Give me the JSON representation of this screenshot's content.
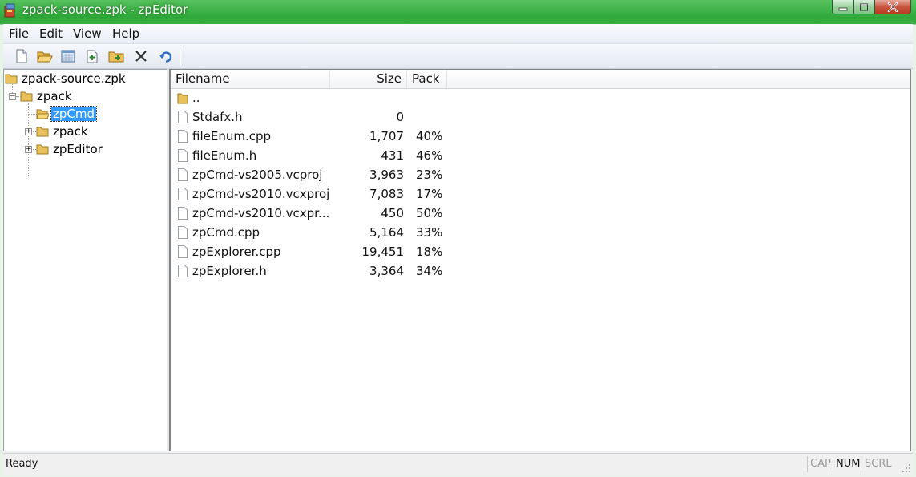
{
  "window": {
    "title": "zpack-source.zpk - zpEditor",
    "colors": {
      "frame": "#3aad45",
      "selection": "#3399ff",
      "folder": "#e8c15a"
    }
  },
  "menu": [
    "File",
    "Edit",
    "View",
    "Help"
  ],
  "toolbar": {
    "buttons": [
      "new-file-icon",
      "open-folder-icon",
      "save-archive-icon",
      "add-file-icon",
      "add-folder-icon",
      "delete-icon",
      "refresh-icon"
    ]
  },
  "tree": {
    "root": "zpack-source.zpk",
    "nodes": [
      {
        "label": "zpack",
        "expanded": true
      },
      {
        "label": "zpCmd",
        "selected": true
      },
      {
        "label": "zpack",
        "expanded": false
      },
      {
        "label": "zpEditor",
        "expanded": false
      }
    ]
  },
  "list": {
    "columns": [
      "Filename",
      "Size",
      "Pack"
    ],
    "rows": [
      {
        "name": "..",
        "size": "",
        "pack": "",
        "type": "folder"
      },
      {
        "name": "Stdafx.h",
        "size": "0",
        "pack": "",
        "type": "file"
      },
      {
        "name": "fileEnum.cpp",
        "size": "1,707",
        "pack": "40%",
        "type": "file"
      },
      {
        "name": "fileEnum.h",
        "size": "431",
        "pack": "46%",
        "type": "file"
      },
      {
        "name": "zpCmd-vs2005.vcproj",
        "size": "3,963",
        "pack": "23%",
        "type": "file"
      },
      {
        "name": "zpCmd-vs2010.vcxproj",
        "size": "7,083",
        "pack": "17%",
        "type": "file"
      },
      {
        "name": "zpCmd-vs2010.vcxpr...",
        "size": "450",
        "pack": "50%",
        "type": "file"
      },
      {
        "name": "zpCmd.cpp",
        "size": "5,164",
        "pack": "33%",
        "type": "file"
      },
      {
        "name": "zpExplorer.cpp",
        "size": "19,451",
        "pack": "18%",
        "type": "file"
      },
      {
        "name": "zpExplorer.h",
        "size": "3,364",
        "pack": "34%",
        "type": "file"
      }
    ]
  },
  "status": {
    "text": "Ready",
    "indicators": [
      {
        "label": "CAP",
        "active": false
      },
      {
        "label": "NUM",
        "active": true
      },
      {
        "label": "SCRL",
        "active": false
      }
    ]
  }
}
